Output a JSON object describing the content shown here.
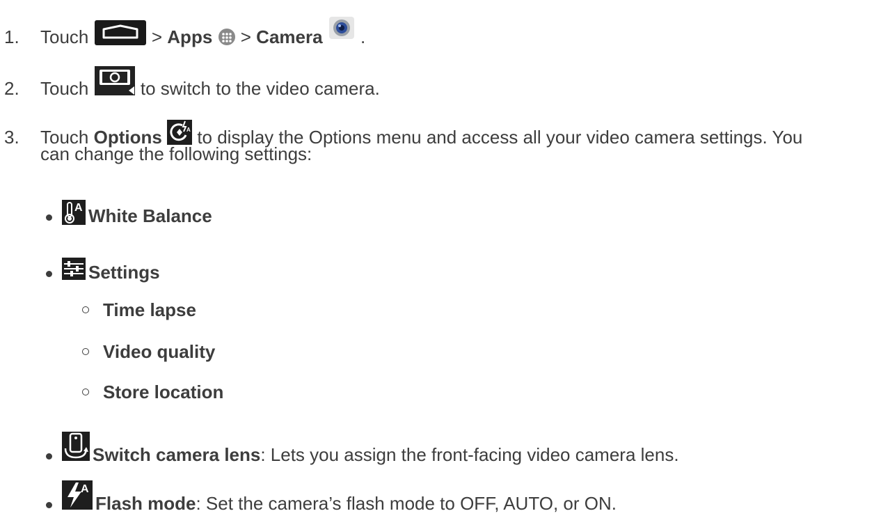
{
  "steps": [
    {
      "num": "1.",
      "pre": "Touch",
      "sep1": ">",
      "apps": "Apps",
      "sep2": ">",
      "camera": "Camera",
      "end": "."
    },
    {
      "num": "2.",
      "pre": "Touch",
      "post": "to switch to the video camera."
    },
    {
      "num": "3.",
      "pre": "Touch",
      "options": "Options",
      "post": "to display the Options menu and access all your video camera settings. You",
      "cont": "can change the following settings:"
    }
  ],
  "bullets": [
    {
      "label": "White Balance",
      "icon": "white-balance-icon"
    },
    {
      "label": "Settings",
      "icon": "settings-sliders-icon"
    },
    {
      "label": "Switch camera lens",
      "icon": "switch-camera-icon",
      "desc": ": Lets you assign the front-facing video camera lens."
    },
    {
      "label": "Flash mode",
      "icon": "flash-auto-icon",
      "desc": ": Set the camera’s flash mode to OFF, AUTO, or ON."
    }
  ],
  "sub_items": [
    "Time lapse",
    "Video quality",
    "Store location"
  ]
}
